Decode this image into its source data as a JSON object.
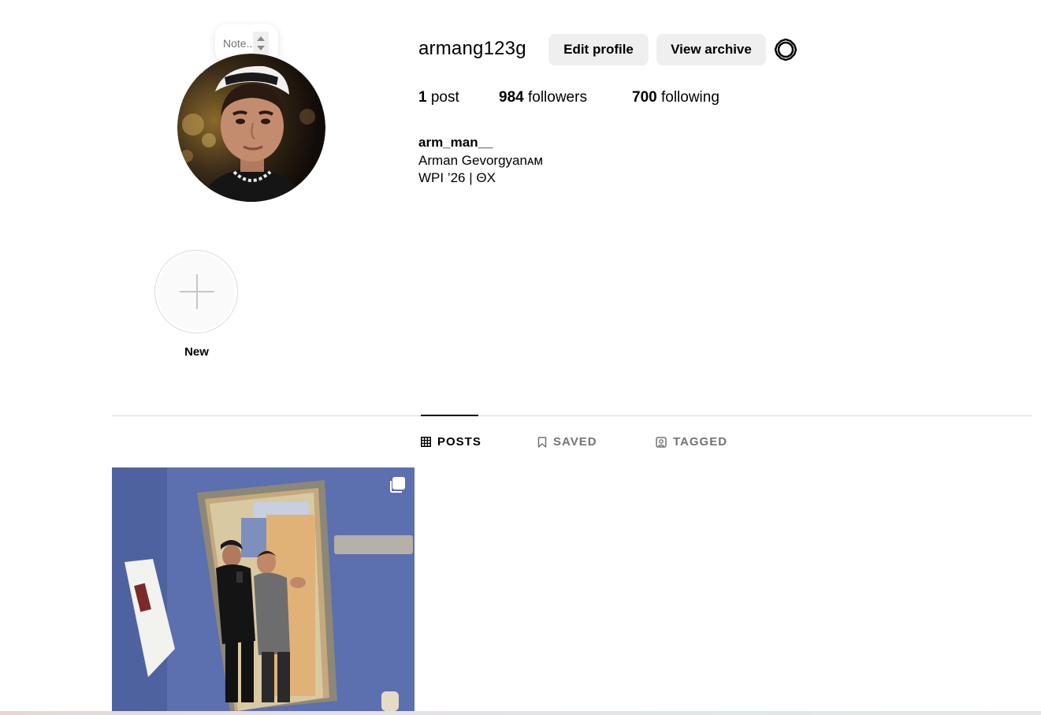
{
  "profile": {
    "username": "armang123g",
    "edit_profile_label": "Edit profile",
    "view_archive_label": "View archive",
    "note_placeholder": "Note...",
    "stats": {
      "posts_count": "1",
      "posts_label": "post",
      "followers_count": "984",
      "followers_label": "followers",
      "following_count": "700",
      "following_label": "following"
    },
    "bio": {
      "name": "arm_man__",
      "line1": "Arman Gevorgyanᴀᴍ",
      "line2": "WPI ’26 | ΘX"
    }
  },
  "highlights": {
    "new_label": "New"
  },
  "tabs": {
    "posts": "POSTS",
    "saved": "SAVED",
    "tagged": "TAGGED",
    "active": "posts"
  },
  "grid": {
    "post_count": 1,
    "multi_image": true
  },
  "icons": {
    "settings": "gear-icon",
    "posts_tab": "grid-icon",
    "saved_tab": "bookmark-icon",
    "tagged_tab": "tagged-user-icon",
    "highlight_add": "plus-icon",
    "carousel": "multiple-images-icon"
  },
  "colors": {
    "button_bg": "#efefef",
    "muted_text": "#737373",
    "divider": "#dbdbdb"
  }
}
